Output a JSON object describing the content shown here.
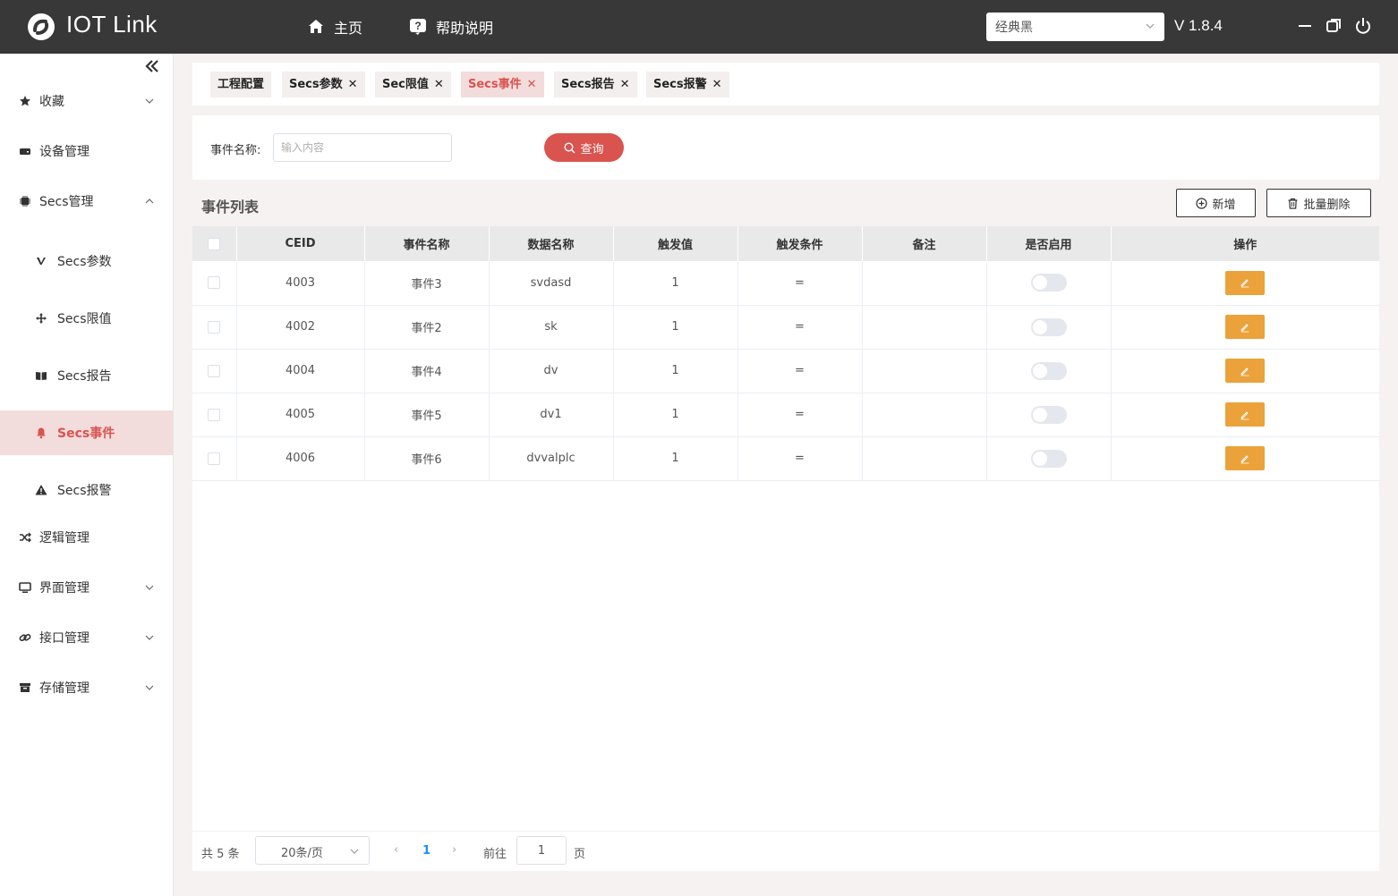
{
  "app": {
    "title": "IOT Link",
    "version": "V 1.8.4"
  },
  "topnav": {
    "home": "主页",
    "help": "帮助说明"
  },
  "theme": {
    "selected": "经典黑"
  },
  "sidebar": {
    "favorites": "收藏",
    "device": "设备管理",
    "secs": "Secs管理",
    "secs_param": "Secs参数",
    "secs_limit": "Secs限值",
    "secs_report": "Secs报告",
    "secs_event": "Secs事件",
    "secs_alarm": "Secs报警",
    "logic": "逻辑管理",
    "ui": "界面管理",
    "interface": "接口管理",
    "storage": "存储管理"
  },
  "tabs": [
    "工程配置",
    "Secs参数",
    "Sec限值",
    "Secs事件",
    "Secs报告",
    "Secs报警"
  ],
  "search": {
    "label": "事件名称:",
    "placeholder": "输入内容",
    "button": "查询"
  },
  "list": {
    "title": "事件列表",
    "add": "新增",
    "batch_delete": "批量删除"
  },
  "table": {
    "headers": [
      "CEID",
      "事件名称",
      "数据名称",
      "触发值",
      "触发条件",
      "备注",
      "是否启用",
      "操作"
    ],
    "rows": [
      {
        "ceid": "4003",
        "name": "事件3",
        "data": "svdasd",
        "value": "1",
        "cond": "=",
        "note": ""
      },
      {
        "ceid": "4002",
        "name": "事件2",
        "data": "sk",
        "value": "1",
        "cond": "=",
        "note": ""
      },
      {
        "ceid": "4004",
        "name": "事件4",
        "data": "dv",
        "value": "1",
        "cond": "=",
        "note": ""
      },
      {
        "ceid": "4005",
        "name": "事件5",
        "data": "dv1",
        "value": "1",
        "cond": "=",
        "note": ""
      },
      {
        "ceid": "4006",
        "name": "事件6",
        "data": "dvvalplc",
        "value": "1",
        "cond": "=",
        "note": ""
      }
    ]
  },
  "pager": {
    "total": "共 5 条",
    "page_size": "20条/页",
    "current": "1",
    "goto": "前往",
    "goto_value": "1",
    "unit": "页"
  },
  "colors": {
    "accent": "#d9534f",
    "edit": "#eba23b",
    "topbar": "#383838"
  }
}
